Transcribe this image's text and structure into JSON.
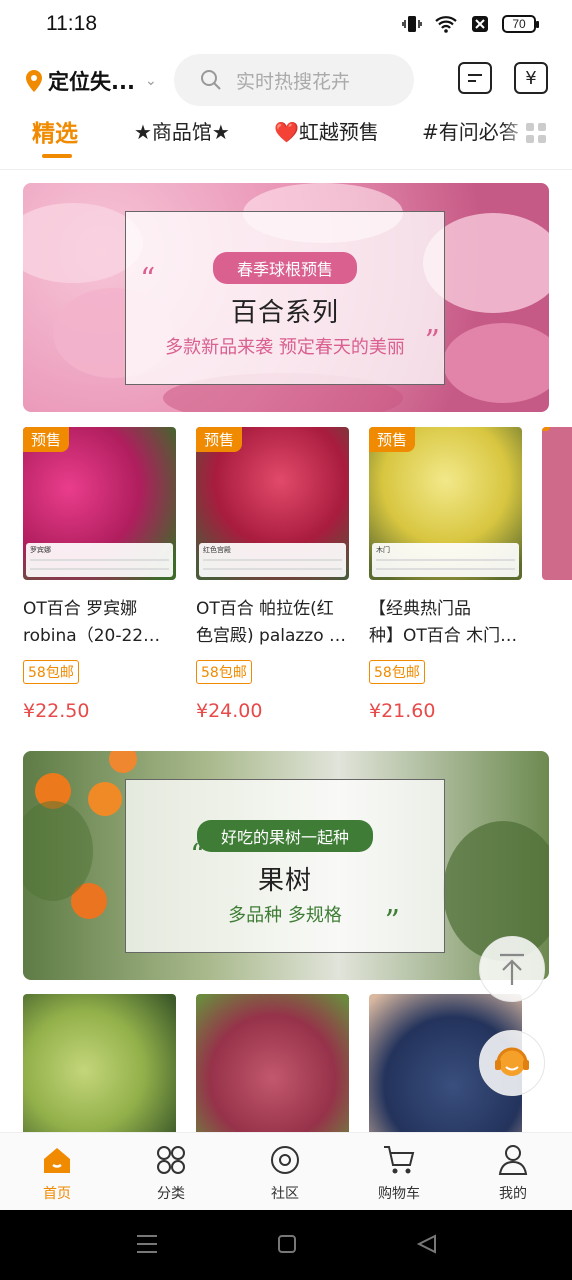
{
  "status_bar": {
    "time": "11:18",
    "battery": "70"
  },
  "header": {
    "location": "定位失...",
    "search_placeholder": "实时热搜花卉"
  },
  "tabs": [
    {
      "label": "精选"
    },
    {
      "label": "★商品馆★"
    },
    {
      "label": "虹越预售"
    },
    {
      "label": "#有问必答"
    }
  ],
  "banner1": {
    "pill": "春季球根预售",
    "title": "百合系列",
    "subtitle": "多款新品来袭 预定春天的美丽"
  },
  "products1": [
    {
      "tag": "预售",
      "info_name": "罗宾娜",
      "name_line1": "OT百合 罗宾娜",
      "name_line2": "robina（20-22）…",
      "badge": "58包邮",
      "price": "¥22.50"
    },
    {
      "tag": "预售",
      "info_name": "红色宫殿",
      "name_line1": "OT百合  帕拉佐(红",
      "name_line2": "色宫殿) palazzo …",
      "badge": "58包邮",
      "price": "¥24.00"
    },
    {
      "tag": "预售",
      "info_name": "木门",
      "name_line1": "【经典热门品",
      "name_line2": "种】OT百合 木门…",
      "badge": "58包邮",
      "price": "¥21.60"
    }
  ],
  "banner2": {
    "pill": "好吃的果树一起种",
    "title": "果树",
    "subtitle": "多品种 多规格"
  },
  "bottom_nav": [
    {
      "label": "首页",
      "icon": "home-icon"
    },
    {
      "label": "分类",
      "icon": "category-icon"
    },
    {
      "label": "社区",
      "icon": "community-icon"
    },
    {
      "label": "购物车",
      "icon": "cart-icon"
    },
    {
      "label": "我的",
      "icon": "profile-icon"
    }
  ],
  "colors": {
    "accent": "#f08a00",
    "price": "#e84a4a",
    "lily_pill": "#d9608f",
    "fruit_pill": "#3f7d36"
  }
}
